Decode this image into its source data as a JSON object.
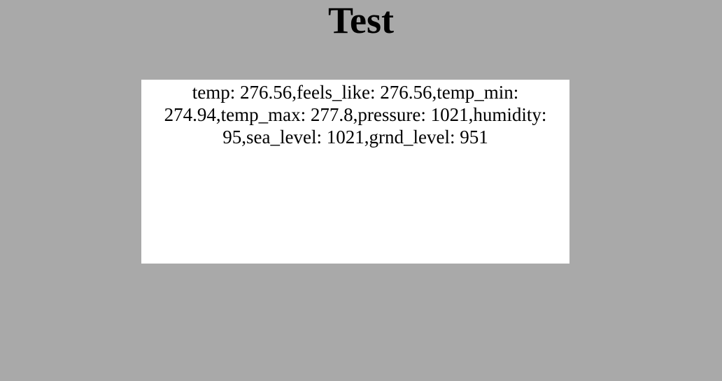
{
  "page": {
    "title": "Test"
  },
  "weather": {
    "text": "temp: 276.56,feels_like: 276.56,temp_min: 274.94,temp_max: 277.8,pressure: 1021,humidity: 95,sea_level: 1021,grnd_level: 951"
  },
  "colors": {
    "background": "#a9a9a9",
    "panel": "#ffffff",
    "text": "#000000"
  }
}
